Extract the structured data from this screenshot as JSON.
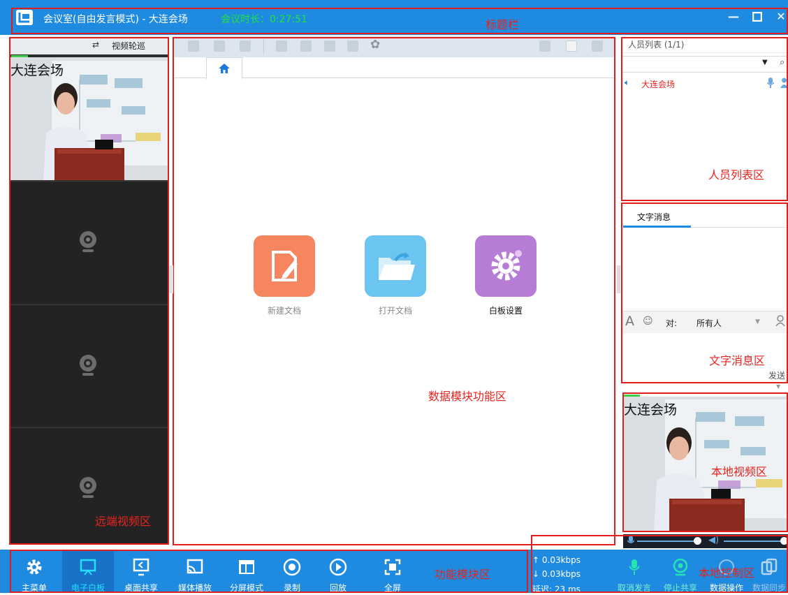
{
  "title_bar": {
    "title": "会议室(自由发言模式) - 大连会场",
    "duration": "会议时长：0:27:51",
    "annotation": "标题栏",
    "colors": {
      "bar": "#1e8ae0",
      "duration_text": "#22e33b"
    }
  },
  "left_panel": {
    "rotate_label": "视频轮巡",
    "rotate_icon": "swap-arrows-icon",
    "first_tile_label": "大连会场",
    "empty_tiles": 3,
    "annotation": "远端视频区"
  },
  "center": {
    "annotation": "数据模块功能区",
    "home_tab_icon": "home-icon",
    "actions": [
      {
        "label": "新建文档",
        "icon": "new-document-icon",
        "color": "#f6865f"
      },
      {
        "label": "打开文档",
        "icon": "open-folder-icon",
        "color": "#6cc4f0"
      },
      {
        "label": "白板设置",
        "icon": "gear-icon",
        "color": "#b67cd6"
      }
    ]
  },
  "people_panel": {
    "header": "人员列表 (1/1)",
    "member": "大连会场",
    "annotation": "人员列表区"
  },
  "message_panel": {
    "tab": "文字消息",
    "to_label": "对:",
    "recipient": "所有人",
    "send": "发送",
    "annotation": "文字消息区"
  },
  "local_video": {
    "label": "大连会场",
    "annotation": "本地视频区"
  },
  "bottom_bar": {
    "annotation_left": "功能模块区",
    "annotation_right": "本地控制区",
    "items": [
      {
        "label": "主菜单",
        "icon": "gear-icon"
      },
      {
        "label": "电子白板",
        "icon": "whiteboard-icon"
      },
      {
        "label": "桌面共享",
        "icon": "desktop-share-icon"
      },
      {
        "label": "媒体播放",
        "icon": "media-cast-icon"
      },
      {
        "label": "分屏模式",
        "icon": "split-screen-icon"
      },
      {
        "label": "录制",
        "icon": "record-icon"
      },
      {
        "label": "回放",
        "icon": "play-icon"
      },
      {
        "label": "全屏",
        "icon": "fullscreen-icon"
      }
    ],
    "stats": {
      "up": "↑ 0.03kbps",
      "down": "↓ 0.03kbps",
      "latency": "延迟: 23 ms"
    },
    "controls": [
      {
        "label": "取消发言",
        "icon": "microphone-icon"
      },
      {
        "label": "停止共享",
        "icon": "webcam-icon"
      },
      {
        "label": "数据操作",
        "icon": "data-icon"
      },
      {
        "label": "数据同步",
        "icon": "sync-icon"
      }
    ]
  }
}
